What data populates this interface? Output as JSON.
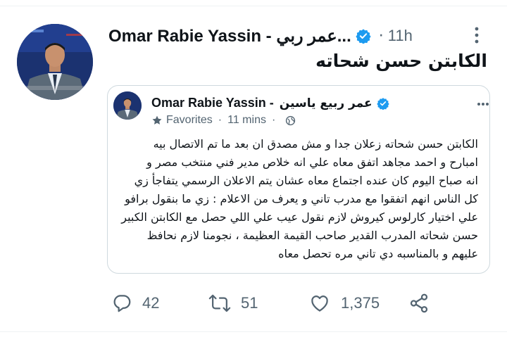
{
  "tweet": {
    "author_name": "Omar Rabie Yassin - عمر ربي...",
    "time": "11h",
    "separator": "·",
    "text": "الكابتن حسن شحاته"
  },
  "quoted": {
    "author_name": "Omar Rabie Yassin -",
    "author_name_ar": "عمر ربيع ياسين",
    "group": "Favorites",
    "time": "11 mins",
    "separator": "·",
    "lines": [
      "الكابتن حسن شحاته زعلان جدا و مش مصدق ان بعد ما تم الاتصال بيه",
      "امبارح و احمد مجاهد اتفق معاه علي انه خلاص مدير فني منتخب مصر و",
      "انه صباح اليوم كان عنده اجتماع معاه عشان يتم الاعلان الرسمي يتفاجأ زي",
      "كل الناس انهم اتفقوا مع مدرب تاني و يعرف من الاعلام : زي ما بنقول برافو",
      "علي اختيار كارلوس كيروش لازم نقول عيب علي اللي حصل مع الكابتن الكبير",
      "حسن شحاته المدرب القدير صاحب القيمة العظيمة ، نجومنا لازم نحافظ",
      "عليهم و بالمناسبه دي تاني مره تحصل معاه"
    ]
  },
  "actions": {
    "replies": "42",
    "retweets": "51",
    "likes": "1,375"
  },
  "colors": {
    "verified": "#1d9bf0",
    "secondary_text": "#536471",
    "border": "#cfd9de"
  }
}
